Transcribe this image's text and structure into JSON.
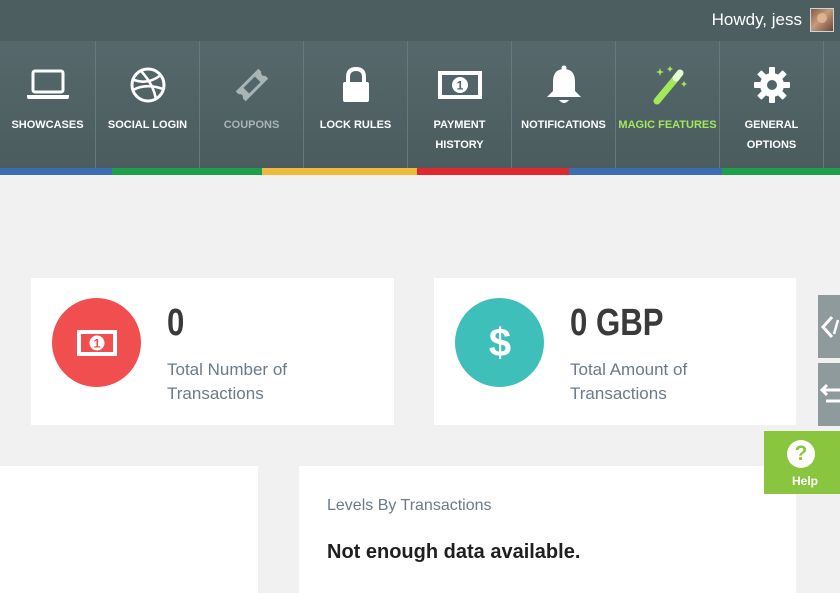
{
  "adminbar": {
    "greeting": "Howdy, jess"
  },
  "nav": {
    "items": [
      {
        "id": "showcases",
        "label": "SHOWCASES",
        "icon": "laptop-icon"
      },
      {
        "id": "social-login",
        "label": "SOCIAL LOGIN",
        "icon": "dribbble-icon"
      },
      {
        "id": "coupons",
        "label": "COUPONS",
        "icon": "ticket-icon"
      },
      {
        "id": "lock-rules",
        "label": "LOCK RULES",
        "icon": "lock-icon"
      },
      {
        "id": "payment-history",
        "label": "PAYMENT HISTORY",
        "icon": "money-icon"
      },
      {
        "id": "notifications",
        "label": "NOTIFICATIONS",
        "icon": "bell-icon"
      },
      {
        "id": "magic-features",
        "label": "MAGIC FEATURES",
        "icon": "magic-wand-icon"
      },
      {
        "id": "general-options",
        "label": "GENERAL OPTIONS",
        "icon": "gear-icon"
      }
    ],
    "colors": {
      "text": "#ffffff",
      "disabled_text": "#a9b4b5",
      "active_text": "#a3e85a",
      "stripe": [
        "#3b6cb4",
        "#1f9e4b",
        "#f1b93c",
        "#e0282f",
        "#3b6cb4",
        "#1f9e4b"
      ]
    }
  },
  "stats": [
    {
      "value": "0",
      "label": "Total Number of Transactions",
      "icon": "money-icon",
      "color": "#f14f4f"
    },
    {
      "value": "0 GBP",
      "label": "Total Amount of Transactions",
      "icon": "dollar-icon",
      "color": "#3fbfb9"
    }
  ],
  "levels": {
    "title": "Levels By Transactions",
    "message": "Not enough data available."
  },
  "help": {
    "label": "Help",
    "icon": "question-icon",
    "color": "#8ac53f"
  }
}
